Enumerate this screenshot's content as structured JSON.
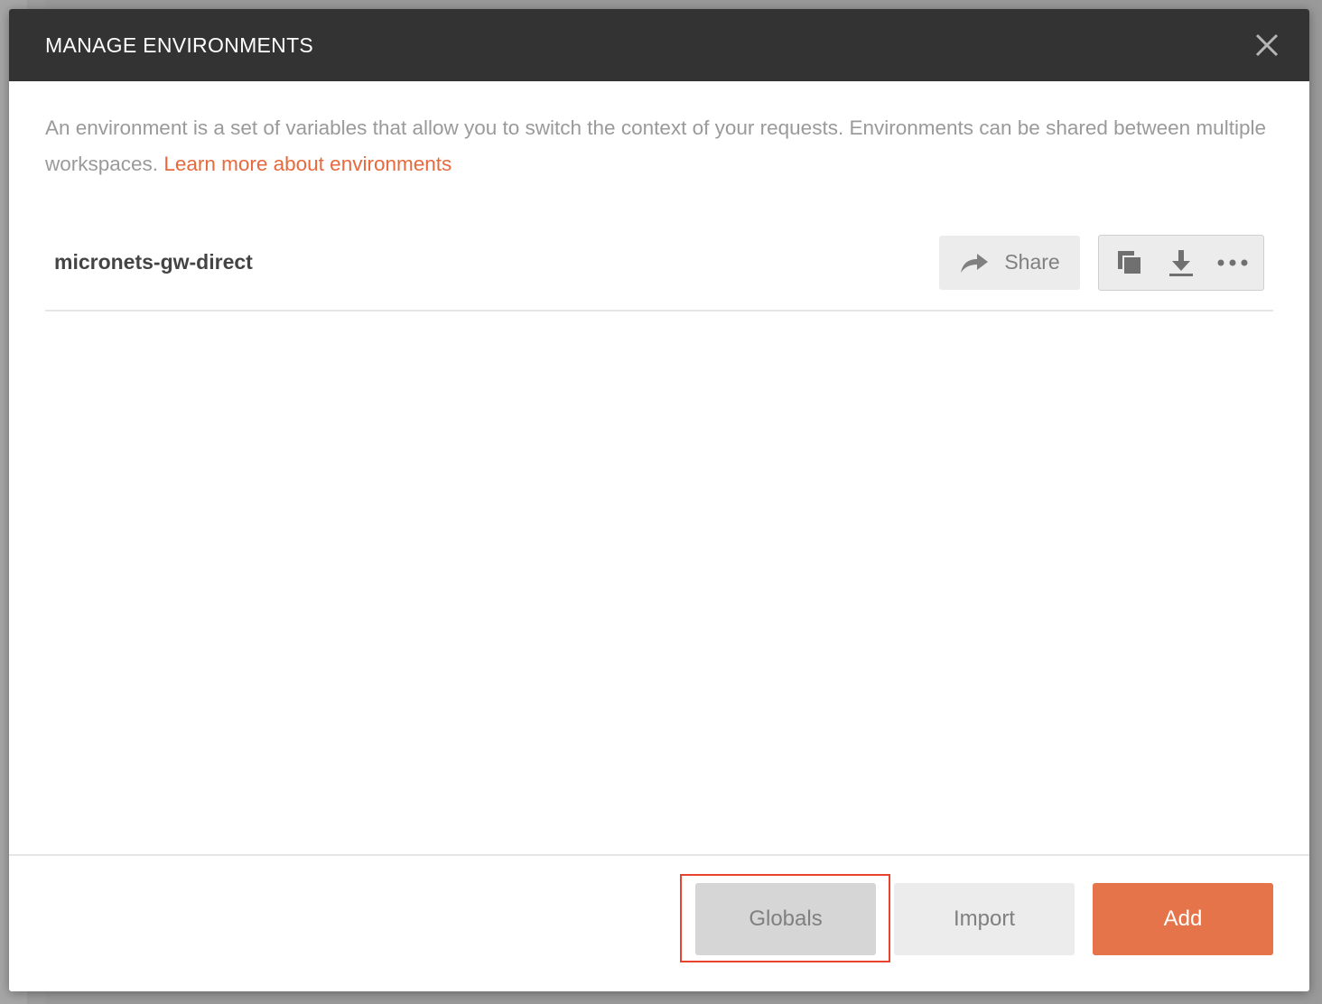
{
  "modal": {
    "title": "MANAGE ENVIRONMENTS",
    "description": "An environment is a set of variables that allow you to switch the context of your requests. Environments can be shared between multiple workspaces.",
    "learn_more_link": "Learn more about environments"
  },
  "environments": [
    {
      "name": "micronets-gw-direct",
      "share_label": "Share"
    }
  ],
  "footer": {
    "globals_label": "Globals",
    "import_label": "Import",
    "add_label": "Add"
  },
  "colors": {
    "header_bg": "#333333",
    "accent": "#e5744a",
    "link": "#e8693e",
    "highlight": "#e8432e"
  },
  "icons": {
    "close": "close-icon",
    "share": "share-arrow-icon",
    "duplicate": "duplicate-icon",
    "download": "download-icon",
    "more": "more-horizontal-icon"
  }
}
